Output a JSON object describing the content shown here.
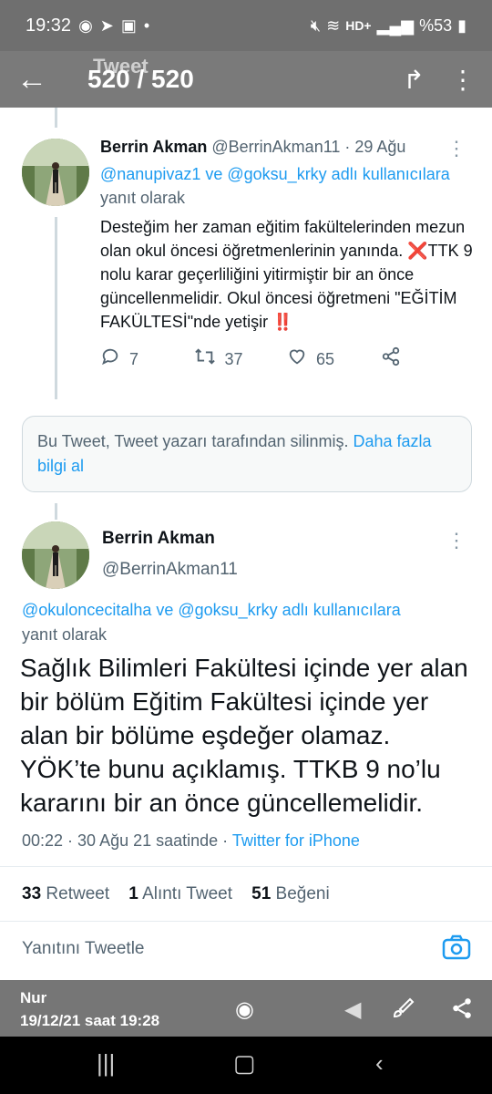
{
  "status_bar": {
    "time": "19:32",
    "network": "HD+",
    "battery": "%53"
  },
  "viewer": {
    "ghost_title": "Tweet",
    "counter": "520 / 520"
  },
  "tweet1": {
    "name": "Berrin Akman",
    "handle": "@BerrinAkman11 · 29 Ağu",
    "reply_to_1": "@nanupivaz1",
    "reply_to_and": " ve ",
    "reply_to_2": "@goksu_krky adlı kullanıcılara",
    "reply_suffix": " yanıt olarak",
    "text_a": "Desteğim her zaman eğitim fakültelerinden mezun olan okul öncesi öğretmenlerinin yanında. ",
    "text_b": "TTK 9 nolu karar geçerliliğini yitirmiştir bir an önce güncellenmelidir. Okul öncesi öğretmeni \"EĞİTİM FAKÜLTESİ\"nde yetişir ",
    "emoji_x": "❌",
    "emoji_bang": "‼️",
    "replies": "7",
    "retweets": "37",
    "likes": "65"
  },
  "deleted_notice": {
    "text": "Bu Tweet, Tweet yazarı tarafından silinmiş. ",
    "link": "Daha fazla bilgi al"
  },
  "tweet2": {
    "name": "Berrin Akman",
    "handle": "@BerrinAkman11",
    "reply_to": "@okuloncecitalha ve @goksu_krky adlı kullanıcılara",
    "reply_suffix": "yanıt olarak",
    "text": "Sağlık Bilimleri Fakültesi içinde yer alan  bir bölüm Eğitim Fakültesi içinde yer alan bir bölüme  eşdeğer olamaz. YÖK’te bunu açıklamış. TTKB 9 no’lu kararını bir an önce  güncellemelidir.",
    "time": "00:22 · 30 Ağu 21 saatinde · ",
    "source": "Twitter for iPhone",
    "retweet_count": "33",
    "retweet_label": "Retweet",
    "quote_count": "1",
    "quote_label": "Alıntı Tweet",
    "like_count": "51",
    "like_label": "Beğeni",
    "reply_placeholder": "Yanıtını Tweetle"
  },
  "gallery_footer": {
    "author": "Nur",
    "date": "19/12/21 saat 19:28"
  }
}
